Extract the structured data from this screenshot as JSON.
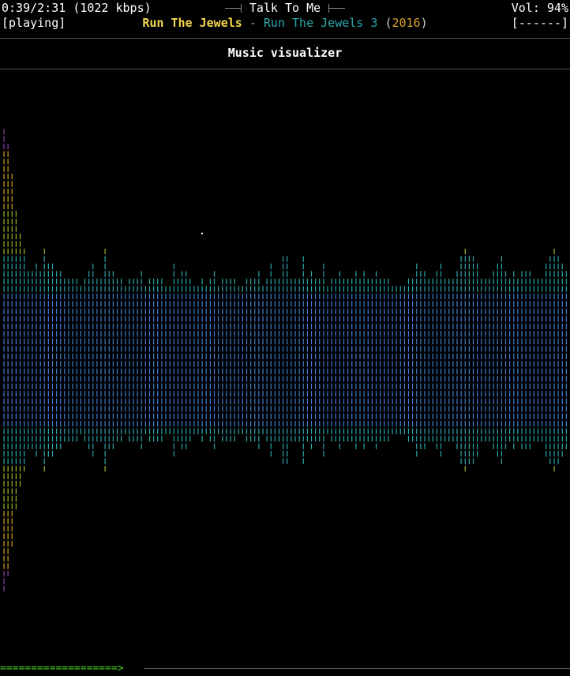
{
  "header": {
    "time": "0:39/2:31",
    "bitrate": "(1022 kbps)",
    "song_title": "Talk To Me",
    "volume": "Vol: 94%",
    "state": "[playing]",
    "artist": "Run The Jewels",
    "separator": " - ",
    "album": "Run The Jewels 3",
    "year": "2016",
    "flags": "[------]"
  },
  "screen": {
    "title": "Music visualizer"
  },
  "progress": {
    "elapsed_seconds": 39,
    "total_seconds": 151,
    "bar": "===================>"
  },
  "visualizer": {
    "glyph": "|",
    "colors": [
      "#8a3fa8",
      "#d4a129",
      "#9ab82e",
      "#2aa8ad",
      "#3f7fd6"
    ],
    "bar_heights": [
      31,
      29,
      25,
      20,
      17,
      15,
      12,
      12,
      13,
      12,
      15,
      13,
      13,
      12,
      12,
      11,
      11,
      11,
      11,
      10,
      11,
      12,
      13,
      11,
      11,
      15,
      12,
      12,
      11,
      11,
      10,
      11,
      11,
      11,
      12,
      10,
      11,
      11,
      11,
      11,
      10,
      10,
      13,
      11,
      12,
      12,
      11,
      10,
      10,
      11,
      10,
      11,
      12,
      10,
      11,
      11,
      11,
      11,
      10,
      10,
      11,
      11,
      11,
      12,
      10,
      11,
      13,
      11,
      11,
      14,
      14,
      11,
      11,
      11,
      14,
      11,
      12,
      11,
      11,
      13,
      10,
      11,
      11,
      12,
      11,
      11,
      11,
      12,
      11,
      12,
      11,
      11,
      12,
      11,
      11,
      11,
      10,
      10,
      10,
      10,
      11,
      11,
      13,
      12,
      12,
      11,
      11,
      12,
      13,
      11,
      11,
      11,
      12,
      14,
      15,
      14,
      14,
      13,
      11,
      11,
      11,
      12,
      13,
      14,
      12,
      11,
      12,
      11,
      12,
      12,
      12,
      11,
      11,
      11,
      13,
      14,
      15,
      14,
      13,
      12
    ]
  }
}
